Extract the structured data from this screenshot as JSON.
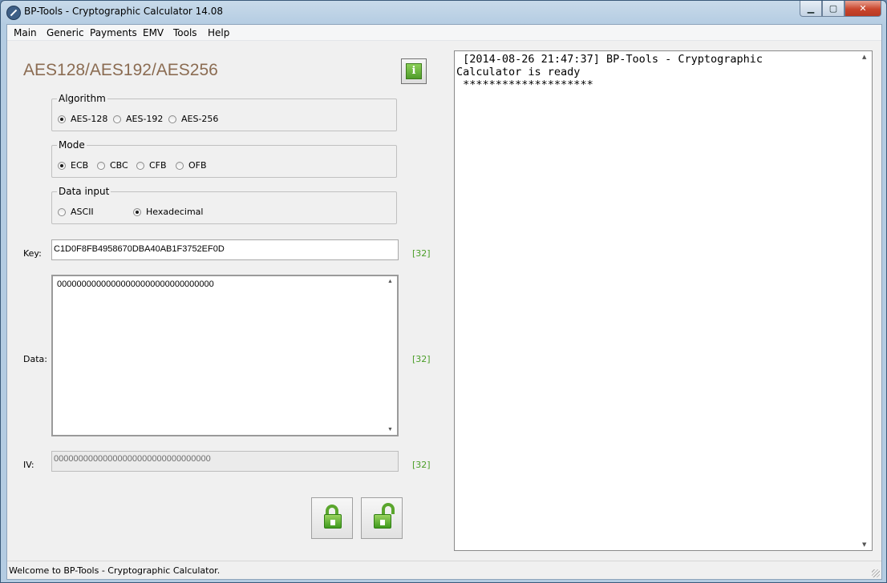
{
  "window": {
    "title": "BP-Tools - Cryptographic Calculator 14.08"
  },
  "menu": {
    "items": [
      "Main",
      "Generic",
      "Payments",
      "EMV",
      "Tools",
      "Help"
    ]
  },
  "panel": {
    "heading": "AES128/AES192/AES256",
    "info_icon_glyph": "i"
  },
  "algorithm": {
    "title": "Algorithm",
    "options": [
      "AES-128",
      "AES-192",
      "AES-256"
    ],
    "selected": "AES-128"
  },
  "mode": {
    "title": "Mode",
    "options": [
      "ECB",
      "CBC",
      "CFB",
      "OFB"
    ],
    "selected": "ECB"
  },
  "data_input": {
    "title": "Data input",
    "options": [
      "ASCII",
      "Hexadecimal"
    ],
    "selected": "Hexadecimal"
  },
  "key": {
    "label": "Key:",
    "value": "C1D0F8FB4958670DBA40AB1F3752EF0D",
    "count": "[32]"
  },
  "data": {
    "label": "Data:",
    "value": "00000000000000000000000000000000",
    "count": "[32]"
  },
  "iv": {
    "label": "IV:",
    "value": "00000000000000000000000000000000",
    "count": "[32]"
  },
  "actions": {
    "encrypt_icon": "lock-closed-icon",
    "decrypt_icon": "lock-open-icon"
  },
  "log": {
    "text": " [2014-08-26 21:47:37] BP-Tools - Cryptographic\nCalculator is ready\n ********************"
  },
  "status": {
    "text": "Welcome to BP-Tools - Cryptographic Calculator."
  },
  "colors": {
    "heading": "#8b6c52",
    "count": "#4a9d27",
    "accent_green": "#4f9c2a"
  }
}
